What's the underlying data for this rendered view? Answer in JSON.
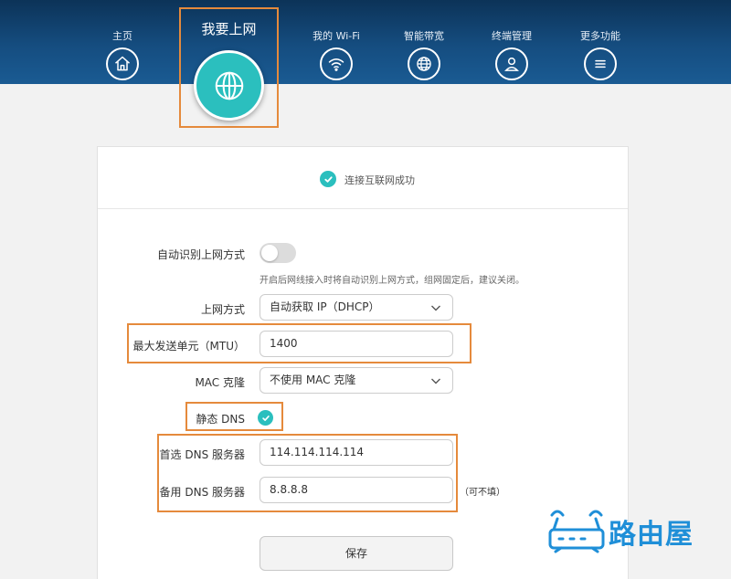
{
  "nav": {
    "items": [
      {
        "label": "主页",
        "icon": "home-icon"
      },
      {
        "label": "我的 Wi-Fi",
        "icon": "wifi-icon"
      },
      {
        "label": "智能带宽",
        "icon": "bandwidth-globe-icon"
      },
      {
        "label": "终端管理",
        "icon": "user-icon"
      },
      {
        "label": "更多功能",
        "icon": "menu-icon"
      }
    ],
    "active": {
      "label": "我要上网",
      "icon": "globe-icon"
    }
  },
  "status": {
    "text": "连接互联网成功",
    "icon": "check-icon"
  },
  "form": {
    "auto_detect": {
      "label": "自动识别上网方式",
      "enabled": false,
      "hint": "开启后网线接入时将自动识别上网方式，组网固定后，建议关闭。"
    },
    "connection_type": {
      "label": "上网方式",
      "value": "自动获取 IP（DHCP）"
    },
    "mtu": {
      "label": "最大发送单元（MTU）",
      "value": "1400"
    },
    "mac_clone": {
      "label": "MAC 克隆",
      "value": "不使用 MAC 克隆"
    },
    "static_dns": {
      "label": "静态 DNS",
      "checked": true
    },
    "primary_dns": {
      "label": "首选 DNS 服务器",
      "value": "114.114.114.114"
    },
    "secondary_dns": {
      "label": "备用 DNS 服务器",
      "value": "8.8.8.8",
      "note": "（可不填）"
    },
    "save_label": "保存"
  },
  "watermark": {
    "text": "路由屋"
  },
  "colors": {
    "nav_bg": "#154d80",
    "accent": "#2bbfbe",
    "highlight": "#e58a3c",
    "logo": "#1f8fd8"
  }
}
